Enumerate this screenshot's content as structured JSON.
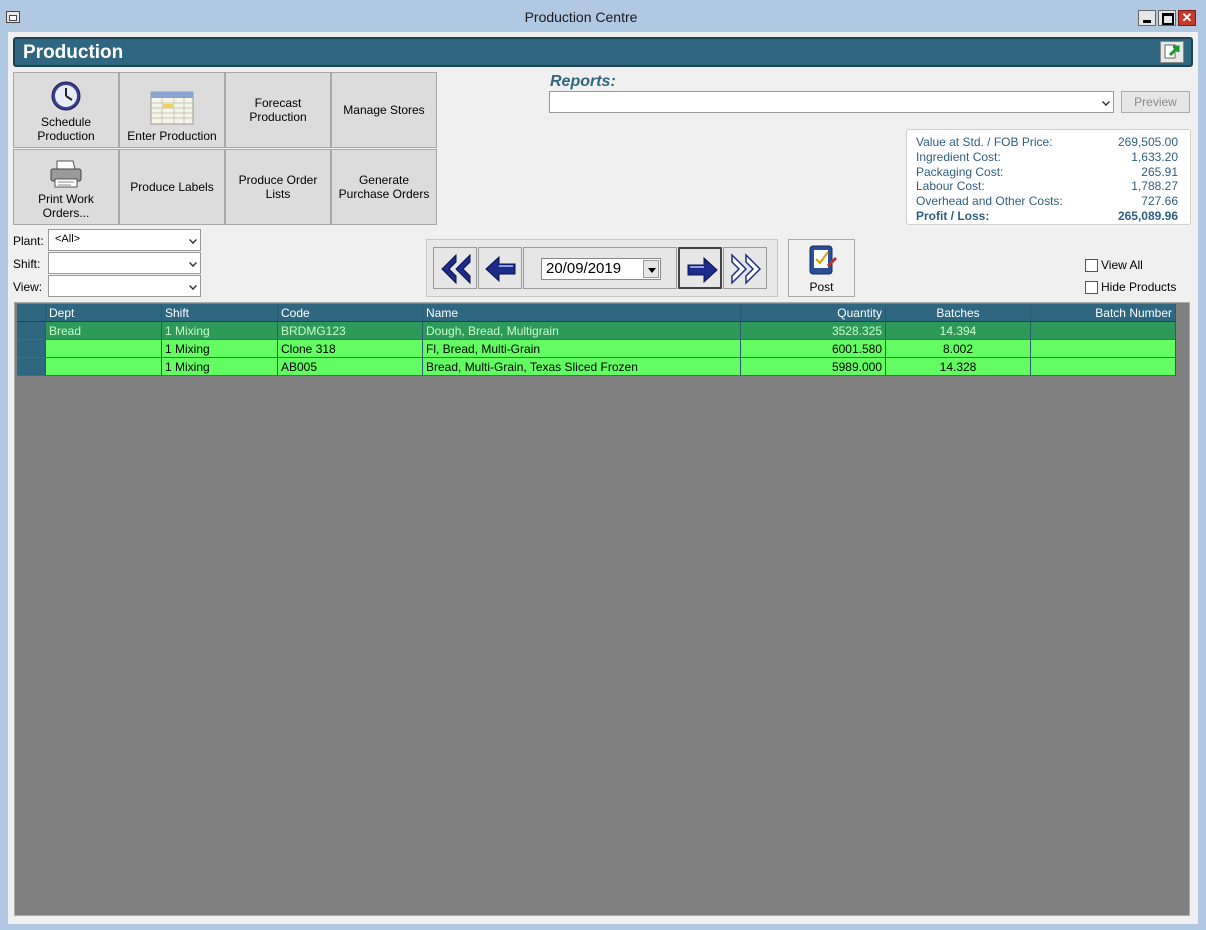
{
  "window": {
    "title": "Production Centre"
  },
  "header": {
    "title": "Production"
  },
  "toolbar": {
    "schedule_production": "Schedule Production",
    "enter_production": "Enter Production",
    "forecast_production": "Forecast Production",
    "manage_stores": "Manage Stores",
    "print_work_orders": "Print Work Orders...",
    "produce_labels": "Produce Labels",
    "produce_order_lists": "Produce Order Lists",
    "generate_purchase_orders": "Generate Purchase Orders"
  },
  "reports": {
    "label": "Reports:",
    "selected": "",
    "preview_label": "Preview"
  },
  "costs": {
    "value_label": "Value at Std. / FOB Price:",
    "value": "269,505.00",
    "ingredient_label": "Ingredient Cost:",
    "ingredient": "1,633.20",
    "packaging_label": "Packaging Cost:",
    "packaging": "265.91",
    "labour_label": "Labour Cost:",
    "labour": "1,788.27",
    "overhead_label": "Overhead and Other Costs:",
    "overhead": "727.66",
    "profit_label": "Profit / Loss:",
    "profit": "265,089.96"
  },
  "filters": {
    "plant_label": "Plant:",
    "plant_value": "<All>",
    "shift_label": "Shift:",
    "shift_value": "",
    "view_label": "View:",
    "view_value": ""
  },
  "navigator": {
    "date": "20/09/2019"
  },
  "post": {
    "label": "Post"
  },
  "options": {
    "view_all": "View All",
    "hide_products": "Hide Products"
  },
  "grid": {
    "columns": [
      "Dept",
      "Shift",
      "Code",
      "Name",
      "Quantity",
      "Batches",
      "Batch Number"
    ],
    "rows": [
      {
        "dept": "Bread",
        "shift": "1 Mixing",
        "code": "BRDMG123",
        "name": "Dough, Bread, Multigrain",
        "quantity": "3528.325",
        "batches": "14.394",
        "batch_number": ""
      },
      {
        "dept": "",
        "shift": "1 Mixing",
        "code": "Clone 318",
        "name": "Fl, Bread, Multi-Grain",
        "quantity": "6001.580",
        "batches": "8.002",
        "batch_number": ""
      },
      {
        "dept": "",
        "shift": "1 Mixing",
        "code": "AB005",
        "name": "Bread, Multi-Grain, Texas Sliced Frozen",
        "quantity": "5989.000",
        "batches": "14.328",
        "batch_number": ""
      }
    ]
  },
  "colors": {
    "accent": "#2f6680",
    "row_green": "#63fc63",
    "row_selected": "#2e9a5a",
    "grid_bg": "#808080"
  }
}
